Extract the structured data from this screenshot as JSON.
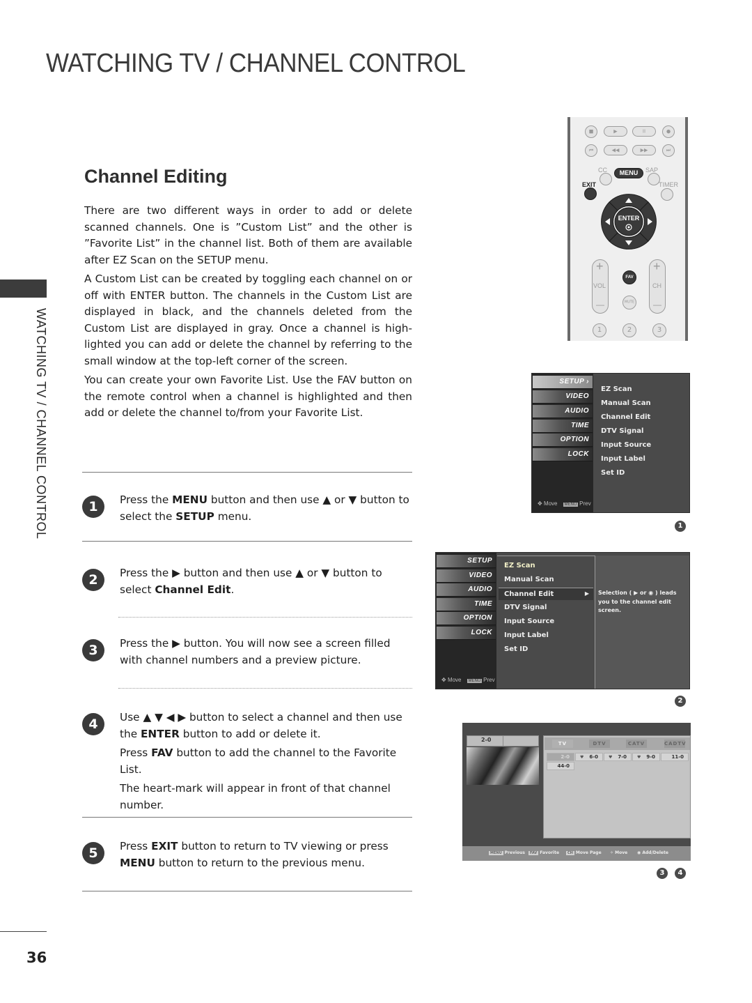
{
  "page": {
    "title": "WATCHING TV / CHANNEL CONTROL",
    "side_label": "WATCHING TV / CHANNEL CONTROL",
    "page_number": "36"
  },
  "section": {
    "title": "Channel Editing",
    "intro": [
      "There are two different ways in order to add or delete scanned channels. One is ”Custom List” and the other is ”Favorite List” in the channel list. Both of them are available after EZ Scan on the SETUP menu.",
      "A Custom List can be created by toggling each channel on or off with ENTER button. The channels in the Custom List are displayed in black, and the channels deleted from the Custom List are displayed in gray. Once a channel is high-lighted you can add or delete the channel by referring to the small window at the top-left corner of the screen.",
      "You can create your own Favorite List. Use the FAV button on the remote control when a channel is highlighted and then add or delete the channel to/from your Favorite List."
    ]
  },
  "steps": [
    {
      "number": "1",
      "parts": [
        {
          "t": "Press the ",
          "b": false
        },
        {
          "t": "MENU",
          "b": true
        },
        {
          "t": " button and then use ▲ or ▼ button to select the ",
          "b": false
        },
        {
          "t": "SETUP",
          "b": true
        },
        {
          "t": " menu.",
          "b": false
        }
      ]
    },
    {
      "number": "2",
      "parts": [
        {
          "t": "Press the ▶ button and then use ▲ or ▼ button to select ",
          "b": false
        },
        {
          "t": "Channel Edit",
          "b": true
        },
        {
          "t": ".",
          "b": false
        }
      ]
    },
    {
      "number": "3",
      "parts": [
        {
          "t": "Press the ▶ button. You will now see a screen filled with channel numbers and a preview picture.",
          "b": false
        }
      ]
    },
    {
      "number": "4",
      "parts": [
        {
          "t": "Use ▲ ▼ ◀ ▶ button to select a channel and then use the ",
          "b": false
        },
        {
          "t": "ENTER",
          "b": true
        },
        {
          "t": " button to add or delete it.",
          "b": false
        }
      ],
      "extra": [
        [
          {
            "t": "Press ",
            "b": false
          },
          {
            "t": "FAV",
            "b": true
          },
          {
            "t": " button to add the channel to the Favorite List.",
            "b": false
          }
        ],
        [
          {
            "t": "The heart-mark will appear in front of that channel number.",
            "b": false
          }
        ]
      ]
    },
    {
      "number": "5",
      "parts": [
        {
          "t": "Press ",
          "b": false
        },
        {
          "t": "EXIT",
          "b": true
        },
        {
          "t": " button  to return to TV viewing or press ",
          "b": false
        },
        {
          "t": "MENU",
          "b": true
        },
        {
          "t": " button to return to the previous menu.",
          "b": false
        }
      ]
    }
  ],
  "remote": {
    "top_row_glyphs": [
      "■",
      "▶",
      "II",
      "●"
    ],
    "second_row_glyphs": [
      "⏮",
      "◀◀",
      "▶▶",
      "⏭"
    ],
    "cc": "CC",
    "menu": "MENU",
    "sap": "SAP",
    "exit": "EXIT",
    "timer": "TIMER",
    "enter": "ENTER",
    "fav": "FAV",
    "vol": "VOL",
    "ch": "CH",
    "mute": "MUTE",
    "plus": "+",
    "minus": "—",
    "numbers": [
      "1",
      "2",
      "3"
    ]
  },
  "osd_setup": {
    "categories": [
      "SETUP ›",
      "VIDEO",
      "AUDIO",
      "TIME",
      "OPTION",
      "LOCK"
    ],
    "items": [
      "EZ Scan",
      "Manual Scan",
      "Channel Edit",
      "DTV Signal",
      "Input Source",
      "Input Label",
      "Set ID"
    ],
    "hint_move": "Move",
    "hint_menu_key": "MENU",
    "hint_prev": "Prev",
    "badge": "1"
  },
  "osd_channel_edit": {
    "categories": [
      "SETUP",
      "VIDEO",
      "AUDIO",
      "TIME",
      "OPTION",
      "LOCK"
    ],
    "items": [
      "EZ Scan",
      "Manual Scan",
      "Channel Edit",
      "DTV Signal",
      "Input Source",
      "Input Label",
      "Set ID"
    ],
    "selected_index": 2,
    "selected_arrow": "▶",
    "description": "Selection ( ▶ or ◉ ) leads you to the channel edit screen.",
    "hint_move": "Move",
    "hint_menu_key": "MENU",
    "hint_prev": "Prev",
    "badge": "2"
  },
  "channel_edit_screen": {
    "preview_channel": "2-0",
    "tabs": [
      "TV",
      "DTV",
      "CATV",
      "CADTV"
    ],
    "active_tab": "TV",
    "channels": [
      {
        "label": "2-0",
        "heart": false,
        "highlighted": true
      },
      {
        "label": "6-0",
        "heart": true,
        "highlighted": false
      },
      {
        "label": "7-0",
        "heart": true,
        "highlighted": false
      },
      {
        "label": "9-0",
        "heart": true,
        "highlighted": false
      },
      {
        "label": "11-0",
        "heart": false,
        "highlighted": false
      },
      {
        "label": "44-0",
        "heart": false,
        "highlighted": false
      }
    ],
    "heart_glyph": "♥",
    "footer": [
      {
        "key": "MENU",
        "label": "Previous"
      },
      {
        "key": "FAV",
        "label": "Favorite"
      },
      {
        "key": "CH",
        "label": "Move Page"
      },
      {
        "key": "✧",
        "label": "Move"
      },
      {
        "key": "◉",
        "label": "Add/Delete"
      }
    ],
    "badges": [
      "3",
      "4"
    ]
  }
}
